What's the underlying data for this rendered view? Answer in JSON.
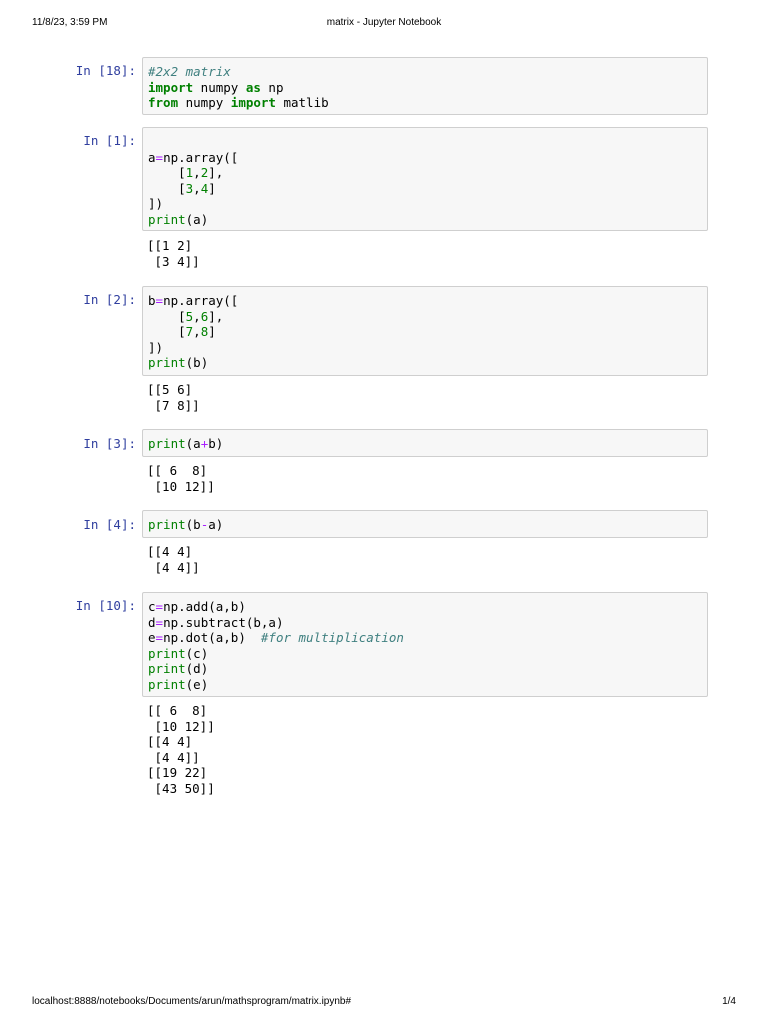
{
  "header": {
    "date": "11/8/23, 3:59 PM",
    "title": "matrix - Jupyter Notebook"
  },
  "footer": {
    "url": "localhost:8888/notebooks/Documents/arun/mathsprogram/matrix.ipynb#",
    "page": "1/4"
  },
  "cells": [
    {
      "prompt": "In [18]:",
      "code": [
        {
          "t": "#2x2 matrix",
          "c": "cm"
        },
        {
          "t": "\n"
        },
        {
          "t": "import",
          "c": "kw"
        },
        {
          "t": " numpy "
        },
        {
          "t": "as",
          "c": "kw"
        },
        {
          "t": " np"
        },
        {
          "t": "\n"
        },
        {
          "t": "from",
          "c": "kw"
        },
        {
          "t": " numpy "
        },
        {
          "t": "import",
          "c": "kw"
        },
        {
          "t": " matlib"
        }
      ],
      "output": ""
    },
    {
      "prompt": "In [1]:",
      "code": [
        {
          "t": "\n"
        },
        {
          "t": "a"
        },
        {
          "t": "=",
          "c": "op"
        },
        {
          "t": "np.array([\n    ["
        },
        {
          "t": "1",
          "c": "num"
        },
        {
          "t": ","
        },
        {
          "t": "2",
          "c": "num"
        },
        {
          "t": "],\n    ["
        },
        {
          "t": "3",
          "c": "num"
        },
        {
          "t": ","
        },
        {
          "t": "4",
          "c": "num"
        },
        {
          "t": "]\n])\n"
        },
        {
          "t": "print",
          "c": "nb"
        },
        {
          "t": "(a)"
        }
      ],
      "output": "[[1 2]\n [3 4]]"
    },
    {
      "prompt": "In [2]:",
      "code": [
        {
          "t": "b"
        },
        {
          "t": "=",
          "c": "op"
        },
        {
          "t": "np.array([\n    ["
        },
        {
          "t": "5",
          "c": "num"
        },
        {
          "t": ","
        },
        {
          "t": "6",
          "c": "num"
        },
        {
          "t": "],\n    ["
        },
        {
          "t": "7",
          "c": "num"
        },
        {
          "t": ","
        },
        {
          "t": "8",
          "c": "num"
        },
        {
          "t": "]\n])\n"
        },
        {
          "t": "print",
          "c": "nb"
        },
        {
          "t": "(b)"
        }
      ],
      "output": "[[5 6]\n [7 8]]"
    },
    {
      "prompt": "In [3]:",
      "code": [
        {
          "t": "print",
          "c": "nb"
        },
        {
          "t": "(a"
        },
        {
          "t": "+",
          "c": "op"
        },
        {
          "t": "b)"
        }
      ],
      "output": "[[ 6  8]\n [10 12]]"
    },
    {
      "prompt": "In [4]:",
      "code": [
        {
          "t": "print",
          "c": "nb"
        },
        {
          "t": "(b"
        },
        {
          "t": "-",
          "c": "op"
        },
        {
          "t": "a)"
        }
      ],
      "output": "[[4 4]\n [4 4]]"
    },
    {
      "prompt": "In [10]:",
      "code": [
        {
          "t": "c"
        },
        {
          "t": "=",
          "c": "op"
        },
        {
          "t": "np.add(a,b)\n"
        },
        {
          "t": "d"
        },
        {
          "t": "=",
          "c": "op"
        },
        {
          "t": "np.subtract(b,a)\n"
        },
        {
          "t": "e"
        },
        {
          "t": "=",
          "c": "op"
        },
        {
          "t": "np.dot(a,b)  "
        },
        {
          "t": "#for multiplication",
          "c": "cm"
        },
        {
          "t": "\n"
        },
        {
          "t": "print",
          "c": "nb"
        },
        {
          "t": "(c)\n"
        },
        {
          "t": "print",
          "c": "nb"
        },
        {
          "t": "(d)\n"
        },
        {
          "t": "print",
          "c": "nb"
        },
        {
          "t": "(e)"
        }
      ],
      "output": "[[ 6  8]\n [10 12]]\n[[4 4]\n [4 4]]\n[[19 22]\n [43 50]]"
    }
  ]
}
